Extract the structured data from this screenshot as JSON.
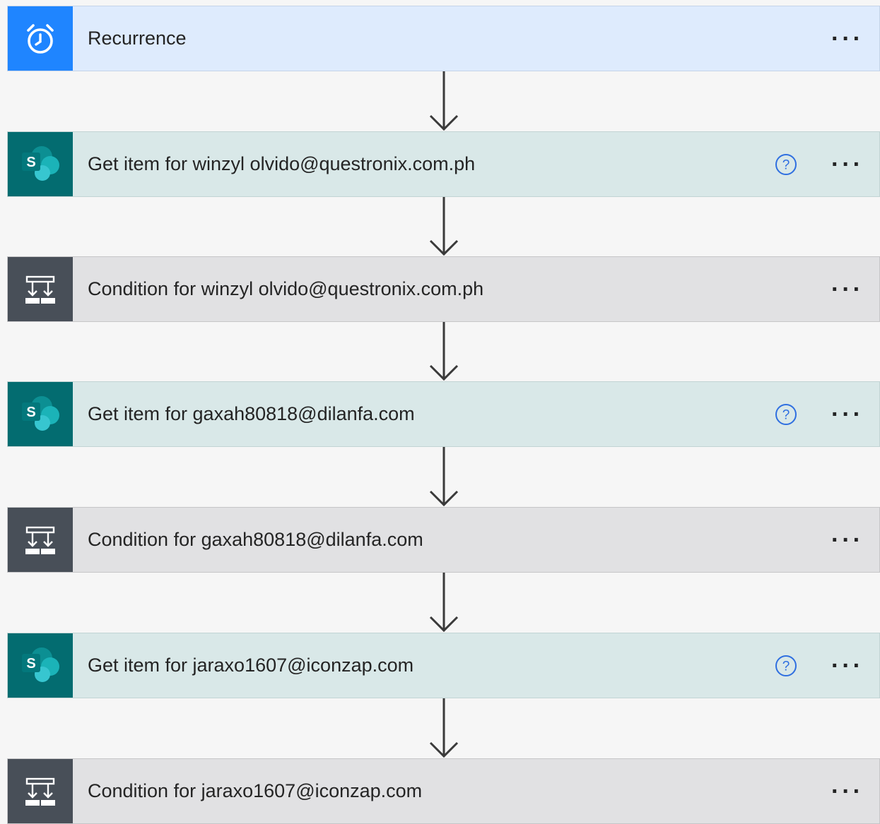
{
  "steps": [
    {
      "type": "trigger",
      "icon": "alarm-clock-icon",
      "title": "Recurrence",
      "help": false,
      "more": "···"
    },
    {
      "type": "sp",
      "icon": "sharepoint-icon",
      "title": "Get item for winzyl olvido@questronix.com.ph",
      "help": true,
      "more": "···"
    },
    {
      "type": "cond",
      "icon": "condition-icon",
      "title": "Condition for winzyl olvido@questronix.com.ph",
      "help": false,
      "more": "···"
    },
    {
      "type": "sp",
      "icon": "sharepoint-icon",
      "title": "Get item for gaxah80818@dilanfa.com",
      "help": true,
      "more": "···"
    },
    {
      "type": "cond",
      "icon": "condition-icon",
      "title": "Condition for gaxah80818@dilanfa.com",
      "help": false,
      "more": "···"
    },
    {
      "type": "sp",
      "icon": "sharepoint-icon",
      "title": "Get item for jaraxo1607@iconzap.com",
      "help": true,
      "more": "···"
    },
    {
      "type": "cond",
      "icon": "condition-icon",
      "title": "Condition for jaraxo1607@iconzap.com",
      "help": false,
      "more": "···"
    }
  ],
  "sharepoint_letter": "S",
  "colors": {
    "trigger_accent": "#1f85ff",
    "sharepoint_accent": "#036c70",
    "condition_accent": "#484f58",
    "help_icon": "#2f6fe0"
  }
}
